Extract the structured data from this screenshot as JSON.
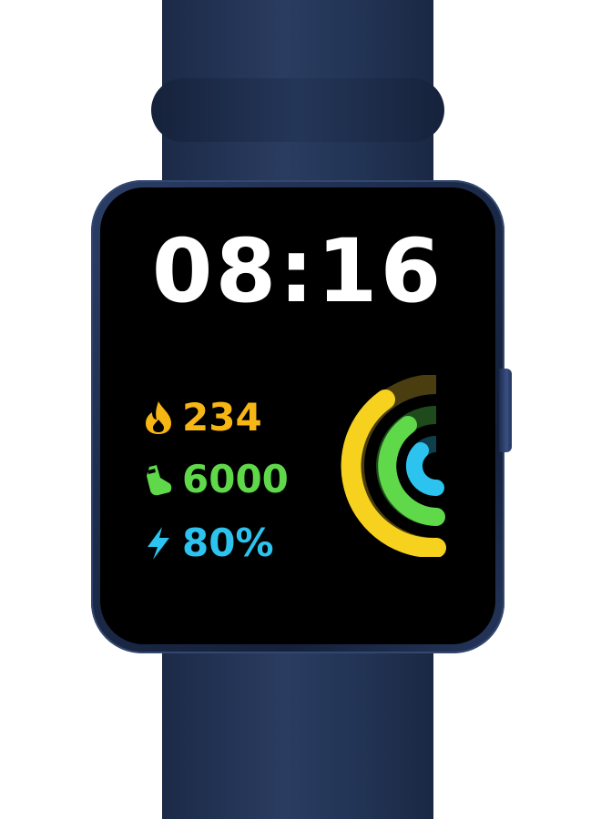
{
  "watch_face": {
    "time": "08:16",
    "stats": {
      "calories": {
        "icon": "flame-icon",
        "value": "234",
        "color": "#f6b614"
      },
      "steps": {
        "icon": "footprint-icon",
        "value": "6000",
        "color": "#5fd84a"
      },
      "battery": {
        "icon": "lightning-icon",
        "value": "80%",
        "color": "#2cc3ee"
      }
    },
    "activity_rings": {
      "calories_progress": 0.78,
      "steps_progress": 0.7,
      "battery_progress": 0.62
    }
  },
  "colors": {
    "strap": "#24365a",
    "screen": "#000000",
    "time_text": "#ffffff"
  }
}
